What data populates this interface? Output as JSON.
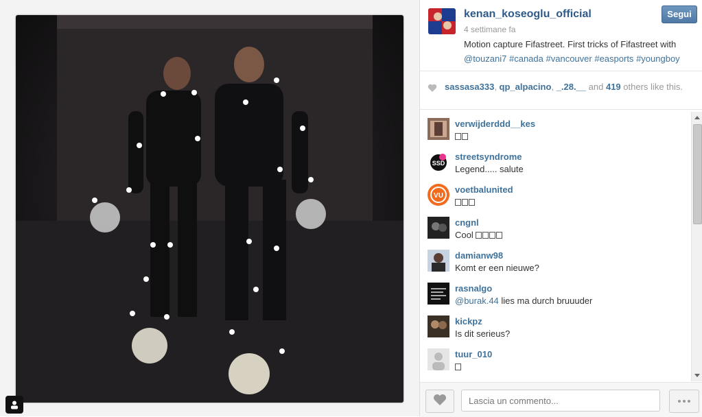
{
  "post": {
    "username": "kenan_koseoglu_official",
    "time_ago": "4 settimane fa",
    "caption": "Motion capture Fifastreet. First tricks of Fifastreet with",
    "tags": [
      "@touzani7",
      "#canada",
      "#vancouver",
      "#easports",
      "#youngboy"
    ],
    "follow_label": "Segui"
  },
  "likes": {
    "users": [
      "sassasa333",
      "qp_alpacino",
      "_.28.__"
    ],
    "conjunction": "and",
    "count": "419",
    "suffix": "others like this."
  },
  "comments": [
    {
      "user": "verwijderddd__kes",
      "text": "",
      "glyphs": 2
    },
    {
      "user": "streetsyndrome",
      "text": "Legend..... salute",
      "glyphs": 0
    },
    {
      "user": "voetbalunited",
      "text": "",
      "glyphs": 3
    },
    {
      "user": "cngnl",
      "text": "Cool",
      "glyphs": 4
    },
    {
      "user": "damianw98",
      "text": "Komt er een nieuwe?",
      "glyphs": 0
    },
    {
      "user": "rasnalgo",
      "mention": "@burak.44",
      "text": " lies ma durch bruuuder",
      "glyphs": 0
    },
    {
      "user": "kickpz",
      "text": "Is dit serieus?",
      "glyphs": 0
    },
    {
      "user": "tuur_010",
      "text": "",
      "glyphs": 1
    }
  ],
  "comment_input": {
    "placeholder": "Lascia un commento..."
  },
  "colors": {
    "link": "#3f729b",
    "username": "#2f5b8a",
    "follow": "#4f7aa6"
  },
  "icons": {
    "heart": "heart-icon",
    "more": "more-dots-icon",
    "usertag": "person-icon"
  }
}
